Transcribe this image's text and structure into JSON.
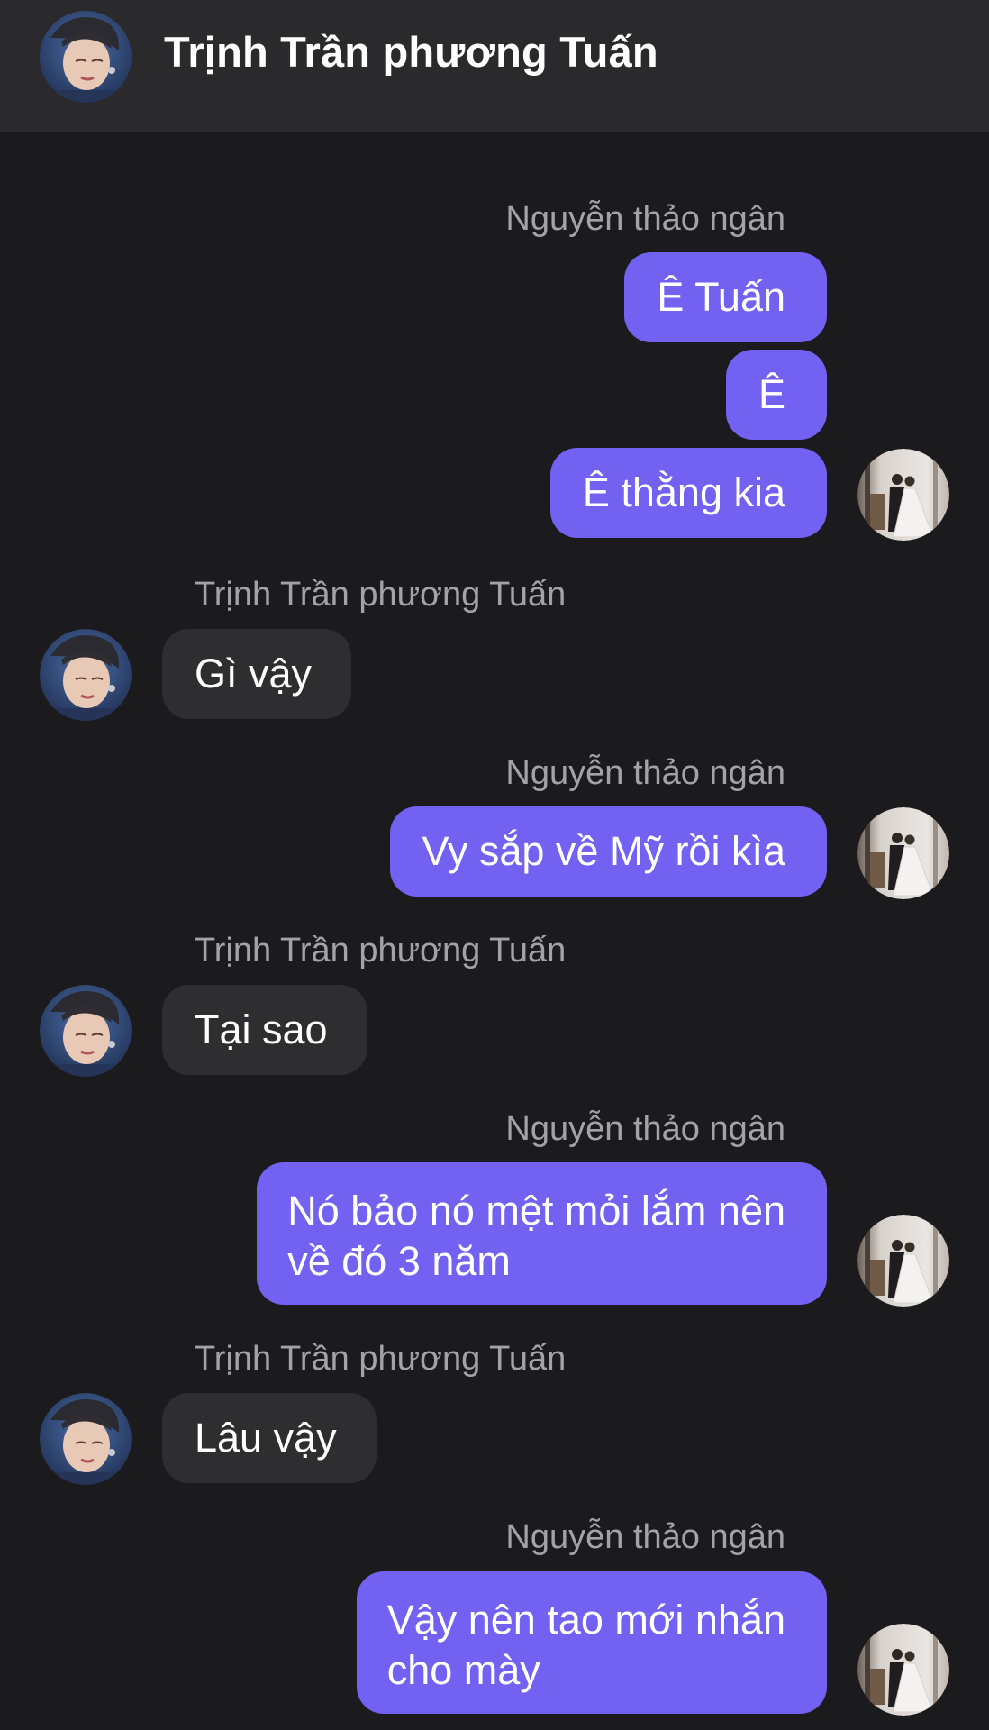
{
  "header": {
    "title": "Trịnh Trần phương Tuấn"
  },
  "messages": [
    {
      "sender": "Nguyễn thảo ngân",
      "direction": "out",
      "texts": [
        "Ê Tuấn",
        "Ê",
        "Ê thằng kia"
      ]
    },
    {
      "sender": "Trịnh Trần phương Tuấn",
      "direction": "in",
      "texts": [
        "Gì vậy"
      ]
    },
    {
      "sender": "Nguyễn thảo ngân",
      "direction": "out",
      "texts": [
        "Vy sắp về Mỹ rồi kìa"
      ]
    },
    {
      "sender": "Trịnh Trần phương Tuấn",
      "direction": "in",
      "texts": [
        "Tại sao"
      ]
    },
    {
      "sender": "Nguyễn thảo ngân",
      "direction": "out",
      "texts": [
        "Nó bảo nó mệt mỏi lắm nên\nvề đó 3 năm"
      ]
    },
    {
      "sender": "Trịnh Trần phương Tuấn",
      "direction": "in",
      "texts": [
        "Lâu vậy"
      ]
    },
    {
      "sender": "Nguyễn thảo ngân",
      "direction": "out",
      "texts": [
        "Vậy nên tao mới nhắn\ncho mày"
      ]
    }
  ],
  "icons": {
    "contact_avatar": "avatar-man-portrait",
    "my_avatar": "avatar-wedding-couple"
  },
  "colors": {
    "background": "#1b1b1d",
    "header": "#2a2a2c",
    "outgoing_bubble": "#7361f2",
    "incoming_bubble": "#2e2e31",
    "sender_name": "#a2a2a8"
  }
}
